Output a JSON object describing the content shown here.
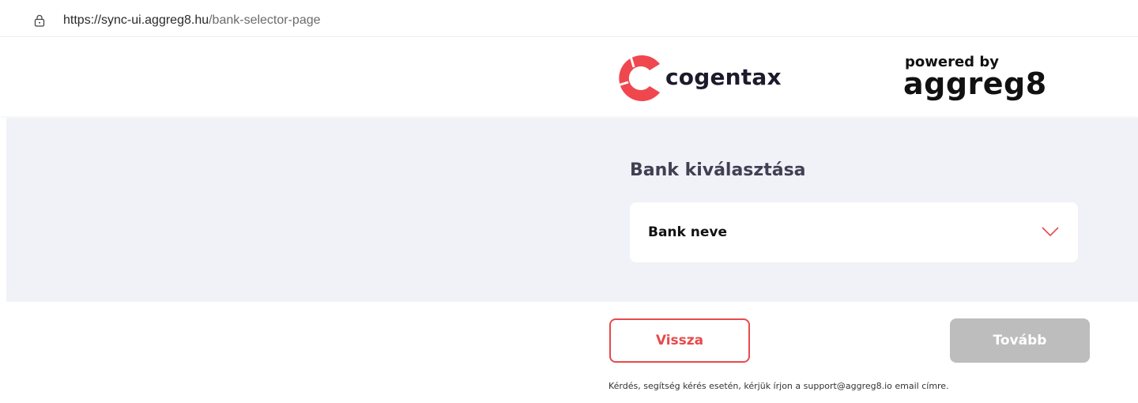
{
  "browser": {
    "url_host": "https://sync-ui.aggreg8.hu",
    "url_path": "/bank-selector-page",
    "lock_icon": "lock-icon"
  },
  "header": {
    "brand_name": "cogentax",
    "brand_color": "#f0474f",
    "powered_by_label": "powered by",
    "partner_name": "aggreg8"
  },
  "bank_selection": {
    "title": "Bank kiválasztása",
    "select_value": "Bank neve",
    "chevron_icon": "chevron-down-icon",
    "accent_color": "#e64b4b"
  },
  "actions": {
    "back_label": "Vissza",
    "next_label": "Tovább",
    "next_disabled": true
  },
  "footer": {
    "help_text": "Kérdés, segítség kérés esetén, kérjük írjon a support@aggreg8.io email címre."
  }
}
